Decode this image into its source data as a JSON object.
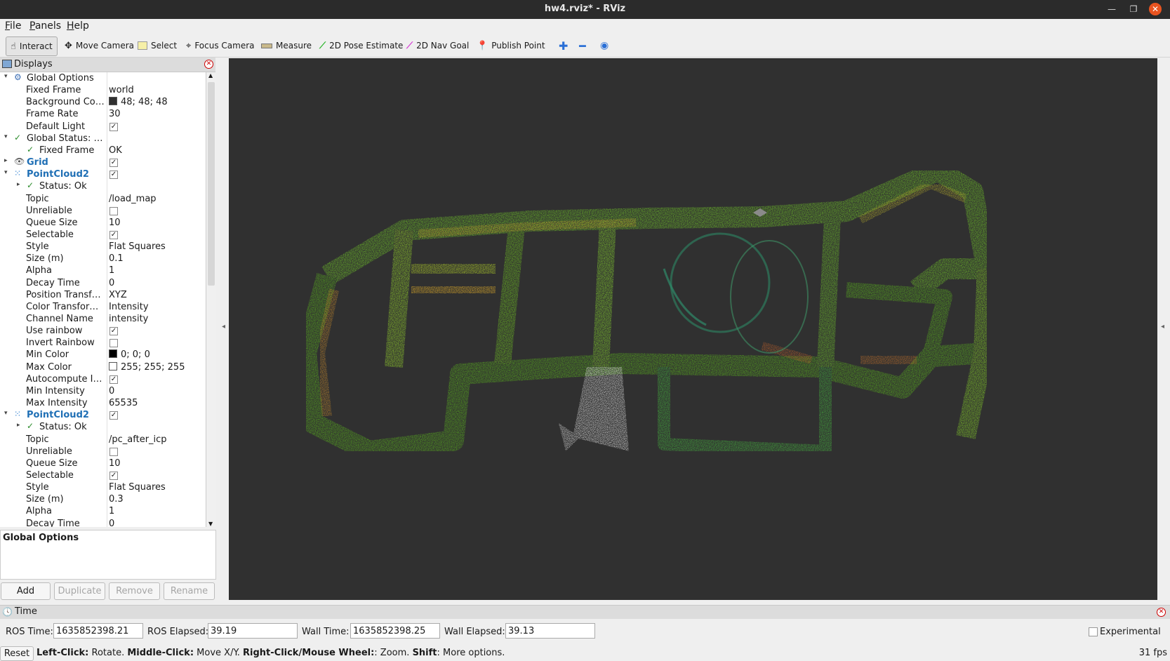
{
  "window": {
    "title": "hw4.rviz* - RViz"
  },
  "menu": [
    "File",
    "Panels",
    "Help"
  ],
  "toolbar": [
    {
      "label": "Interact",
      "icon": "cursor-hand-icon"
    },
    {
      "label": "Move Camera",
      "icon": "move-camera-icon"
    },
    {
      "label": "Select",
      "icon": "select-box-icon"
    },
    {
      "label": "Focus Camera",
      "icon": "focus-camera-icon"
    },
    {
      "label": "Measure",
      "icon": "ruler-icon"
    },
    {
      "label": "2D Pose Estimate",
      "icon": "green-arrow-icon"
    },
    {
      "label": "2D Nav Goal",
      "icon": "pink-arrow-icon"
    },
    {
      "label": "Publish Point",
      "icon": "map-pin-icon"
    }
  ],
  "displays": {
    "title": "Displays",
    "rows": [
      {
        "indent": 0,
        "expand": "open",
        "icon": "gear",
        "name": "Global Options",
        "type": "header"
      },
      {
        "indent": 1,
        "name": "Fixed Frame",
        "value": "world"
      },
      {
        "indent": 1,
        "name": "Background Color",
        "value": "48; 48; 48",
        "swatch": "#303030"
      },
      {
        "indent": 1,
        "name": "Frame Rate",
        "value": "30"
      },
      {
        "indent": 1,
        "name": "Default Light",
        "check": true
      },
      {
        "indent": 0,
        "expand": "open",
        "icon": "check",
        "name": "Global Status: Ok",
        "type": "header"
      },
      {
        "indent": 2,
        "icon": "check",
        "name": "Fixed Frame",
        "value": "OK"
      },
      {
        "indent": 0,
        "expand": "closed",
        "icon": "grid",
        "name": "Grid",
        "blue": true,
        "check": true
      },
      {
        "indent": 0,
        "expand": "open",
        "icon": "cloud",
        "name": "PointCloud2",
        "blue": true,
        "check": true
      },
      {
        "indent": 1,
        "expand": "closed",
        "icon": "check",
        "name": "Status: Ok",
        "sub": true
      },
      {
        "indent": 1,
        "name": "Topic",
        "value": "/load_map"
      },
      {
        "indent": 1,
        "name": "Unreliable",
        "check": false
      },
      {
        "indent": 1,
        "name": "Queue Size",
        "value": "10"
      },
      {
        "indent": 1,
        "name": "Selectable",
        "check": true
      },
      {
        "indent": 1,
        "name": "Style",
        "value": "Flat Squares"
      },
      {
        "indent": 1,
        "name": "Size (m)",
        "value": "0.1"
      },
      {
        "indent": 1,
        "name": "Alpha",
        "value": "1"
      },
      {
        "indent": 1,
        "name": "Decay Time",
        "value": "0"
      },
      {
        "indent": 1,
        "name": "Position Transf…",
        "value": "XYZ"
      },
      {
        "indent": 1,
        "name": "Color Transfor…",
        "value": "Intensity"
      },
      {
        "indent": 1,
        "name": "Channel Name",
        "value": "intensity"
      },
      {
        "indent": 1,
        "name": "Use rainbow",
        "check": true
      },
      {
        "indent": 1,
        "name": "Invert Rainbow",
        "check": false
      },
      {
        "indent": 1,
        "name": "Min Color",
        "value": "0; 0; 0",
        "swatch": "#000000"
      },
      {
        "indent": 1,
        "name": "Max Color",
        "value": "255; 255; 255",
        "swatch": "#ffffff"
      },
      {
        "indent": 1,
        "name": "Autocompute I…",
        "check": true
      },
      {
        "indent": 1,
        "name": "Min Intensity",
        "value": "0"
      },
      {
        "indent": 1,
        "name": "Max Intensity",
        "value": "65535"
      },
      {
        "indent": 0,
        "expand": "open",
        "icon": "cloud",
        "name": "PointCloud2",
        "blue": true,
        "check": true
      },
      {
        "indent": 1,
        "expand": "closed",
        "icon": "check",
        "name": "Status: Ok",
        "sub": true
      },
      {
        "indent": 1,
        "name": "Topic",
        "value": "/pc_after_icp"
      },
      {
        "indent": 1,
        "name": "Unreliable",
        "check": false
      },
      {
        "indent": 1,
        "name": "Queue Size",
        "value": "10"
      },
      {
        "indent": 1,
        "name": "Selectable",
        "check": true
      },
      {
        "indent": 1,
        "name": "Style",
        "value": "Flat Squares"
      },
      {
        "indent": 1,
        "name": "Size (m)",
        "value": "0.3"
      },
      {
        "indent": 1,
        "name": "Alpha",
        "value": "1"
      },
      {
        "indent": 1,
        "name": "Decay Time",
        "value": "0"
      }
    ],
    "description_title": "Global Options",
    "buttons": {
      "add": "Add",
      "duplicate": "Duplicate",
      "remove": "Remove",
      "rename": "Rename"
    }
  },
  "time": {
    "title": "Time",
    "ros_time_label": "ROS Time:",
    "ros_time": "1635852398.21",
    "ros_elapsed_label": "ROS Elapsed:",
    "ros_elapsed": "39.19",
    "wall_time_label": "Wall Time:",
    "wall_time": "1635852398.25",
    "wall_elapsed_label": "Wall Elapsed:",
    "wall_elapsed": "39.13",
    "experimental_label": "Experimental"
  },
  "status": {
    "reset": "Reset",
    "hint_parts": [
      {
        "bold": "Left-Click:",
        "text": " Rotate. "
      },
      {
        "bold": "Middle-Click:",
        "text": " Move X/Y. "
      },
      {
        "bold": "Right-Click/Mouse Wheel:",
        "text": ": Zoom. "
      },
      {
        "bold": "Shift",
        "text": ": More options."
      }
    ],
    "fps": "31 fps"
  },
  "colors": {
    "viewport_bg": "#303030",
    "accent_blue": "#1f6fb5",
    "close_orange": "#e95420"
  }
}
